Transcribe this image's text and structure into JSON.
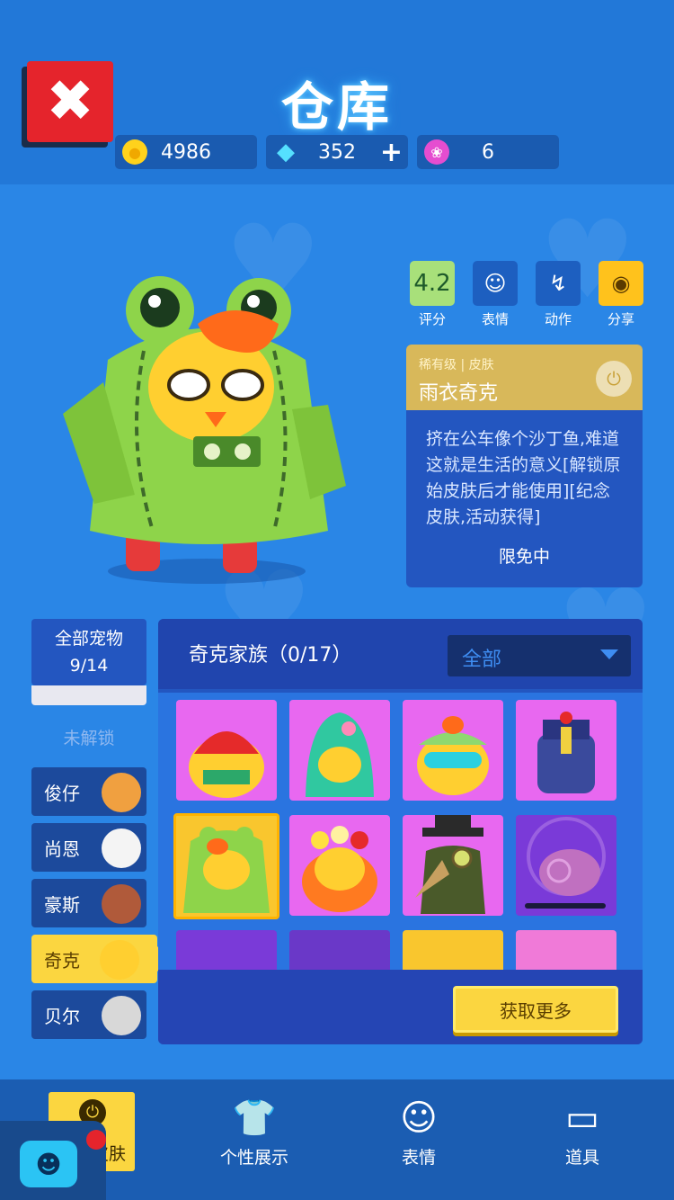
{
  "header": {
    "title": "仓库",
    "close_icon": "close-x-icon",
    "currencies": [
      {
        "icon": "coin-icon",
        "value": "4986"
      },
      {
        "icon": "diamond-icon",
        "value": "352",
        "has_plus": true
      },
      {
        "icon": "lotus-token-icon",
        "value": "6"
      }
    ]
  },
  "actions": [
    {
      "name": "rating",
      "value": "4.2",
      "label": "评分"
    },
    {
      "name": "emote",
      "icon": "chat-smile-icon",
      "label": "表情"
    },
    {
      "name": "action",
      "icon": "running-icon",
      "label": "动作"
    },
    {
      "name": "share",
      "icon": "camera-icon",
      "label": "分享"
    }
  ],
  "skin_info": {
    "rarity": "稀有级",
    "type": "皮肤",
    "name": "雨衣奇克",
    "description": "挤在公车像个沙丁鱼,难道这就是生活的意义[解锁原始皮肤后才能使用][纪念皮肤,活动获得]",
    "status": "限免中"
  },
  "sidebar": {
    "header_line1": "全部宠物",
    "header_line2": "9/14",
    "locked_label": "未解锁",
    "pets": [
      {
        "label": "俊仔",
        "avatar_color": "#f0a040",
        "active": false
      },
      {
        "label": "尚恩",
        "avatar_color": "#f4f4f4",
        "active": false
      },
      {
        "label": "豪斯",
        "avatar_color": "#b05a3a",
        "active": false
      },
      {
        "label": "奇克",
        "avatar_color": "#ffcf30",
        "active": true
      },
      {
        "label": "贝尔",
        "avatar_color": "#d8d8d8",
        "active": false
      }
    ]
  },
  "skins_panel": {
    "family_title": "奇克家族（0/17）",
    "filter_value": "全部",
    "get_more": "获取更多"
  },
  "bottom_nav": [
    {
      "label": "宠物皮肤",
      "icon": "plug-icon",
      "active": true
    },
    {
      "label": "个性展示",
      "icon": "tshirt-icon",
      "active": false
    },
    {
      "label": "表情",
      "icon": "chat-smile-icon",
      "active": false
    },
    {
      "label": "道具",
      "icon": "card-icon",
      "active": false
    }
  ],
  "colors": {
    "background": "#2a86e6",
    "accent_yellow": "#fbd640",
    "close_red": "#e5242c",
    "tile_pink": "#e868f0",
    "tile_violet": "#7a3ad8"
  }
}
